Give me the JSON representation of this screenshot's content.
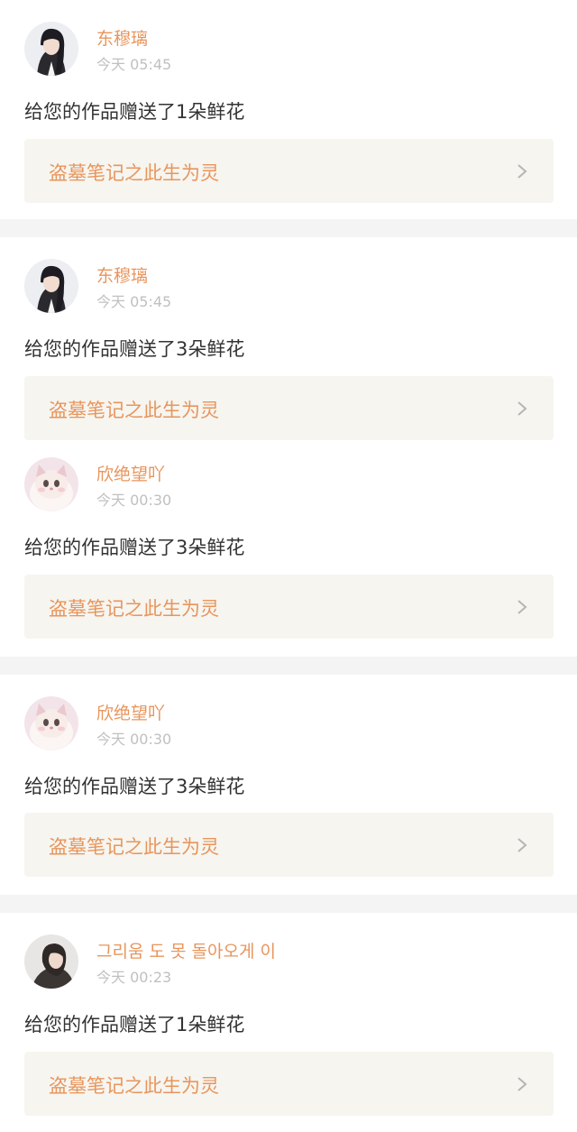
{
  "notifications": [
    {
      "user": "东穆璃",
      "time": "今天 05:45",
      "message": "给您的作品赠送了1朵鲜花",
      "work": "盗墓笔记之此生为灵",
      "avatar": "girl-portrait-avatar"
    },
    {
      "user": "东穆璃",
      "time": "今天 05:45",
      "message": "给您的作品赠送了3朵鲜花",
      "work": "盗墓笔记之此生为灵",
      "avatar": "girl-portrait-avatar"
    },
    {
      "user": "欣绝望吖",
      "time": "今天 00:30",
      "message": "给您的作品赠送了3朵鲜花",
      "work": "盗墓笔记之此生为灵",
      "avatar": "cat-avatar"
    },
    {
      "user": "欣绝望吖",
      "time": "今天 00:30",
      "message": "给您的作品赠送了3朵鲜花",
      "work": "盗墓笔记之此生为灵",
      "avatar": "cat-avatar"
    },
    {
      "user": "그리움 도 못 돌아오게 이",
      "time": "今天 00:23",
      "message": "给您的作品赠送了1朵鲜花",
      "work": "盗墓笔记之此生为灵",
      "avatar": "girl-side-avatar"
    }
  ],
  "colors": {
    "accent": "#e8955c",
    "text": "#333333",
    "muted": "#c0c0c0",
    "card_bg": "#f6f5f0",
    "divider": "#f4f4f4"
  }
}
